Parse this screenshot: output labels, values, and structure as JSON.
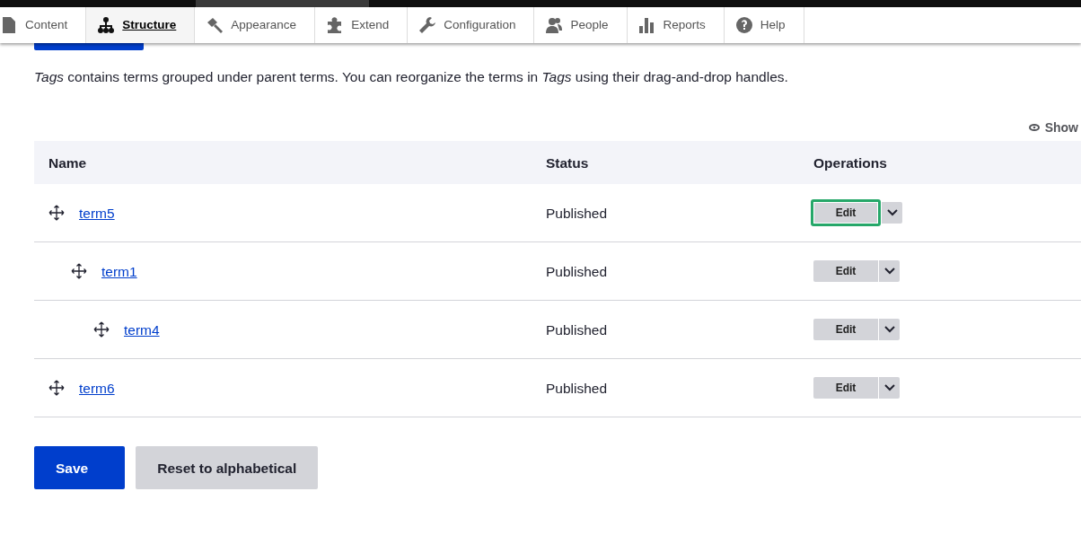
{
  "toolbar": {
    "items": [
      {
        "label": "Content",
        "selected": false
      },
      {
        "label": "Structure",
        "selected": true
      },
      {
        "label": "Appearance",
        "selected": false
      },
      {
        "label": "Extend",
        "selected": false
      },
      {
        "label": "Configuration",
        "selected": false
      },
      {
        "label": "People",
        "selected": false
      },
      {
        "label": "Reports",
        "selected": false
      },
      {
        "label": "Help",
        "selected": false
      }
    ]
  },
  "description": "*Tags* contains terms grouped under parent terms. You can reorganize the terms in *Tags* using their drag-and-drop handles.",
  "show_toggle": "Show",
  "table": {
    "columns": [
      "Name",
      "Status",
      "Operations"
    ],
    "rows": [
      {
        "name": "term5",
        "status": "Published",
        "operation": "Edit",
        "focused": true,
        "children": [
          {
            "name": "term1",
            "status": "Published",
            "operation": "Edit",
            "focused": false,
            "children": [
              {
                "name": "term4",
                "status": "Published",
                "operation": "Edit",
                "focused": false
              }
            ]
          }
        ]
      },
      {
        "name": "term6",
        "status": "Published",
        "operation": "Edit",
        "focused": false
      }
    ]
  },
  "buttons": [
    {
      "label": "Save",
      "kind": "primary"
    },
    {
      "label": "Reset to alphabetical",
      "kind": "secondary"
    }
  ]
}
